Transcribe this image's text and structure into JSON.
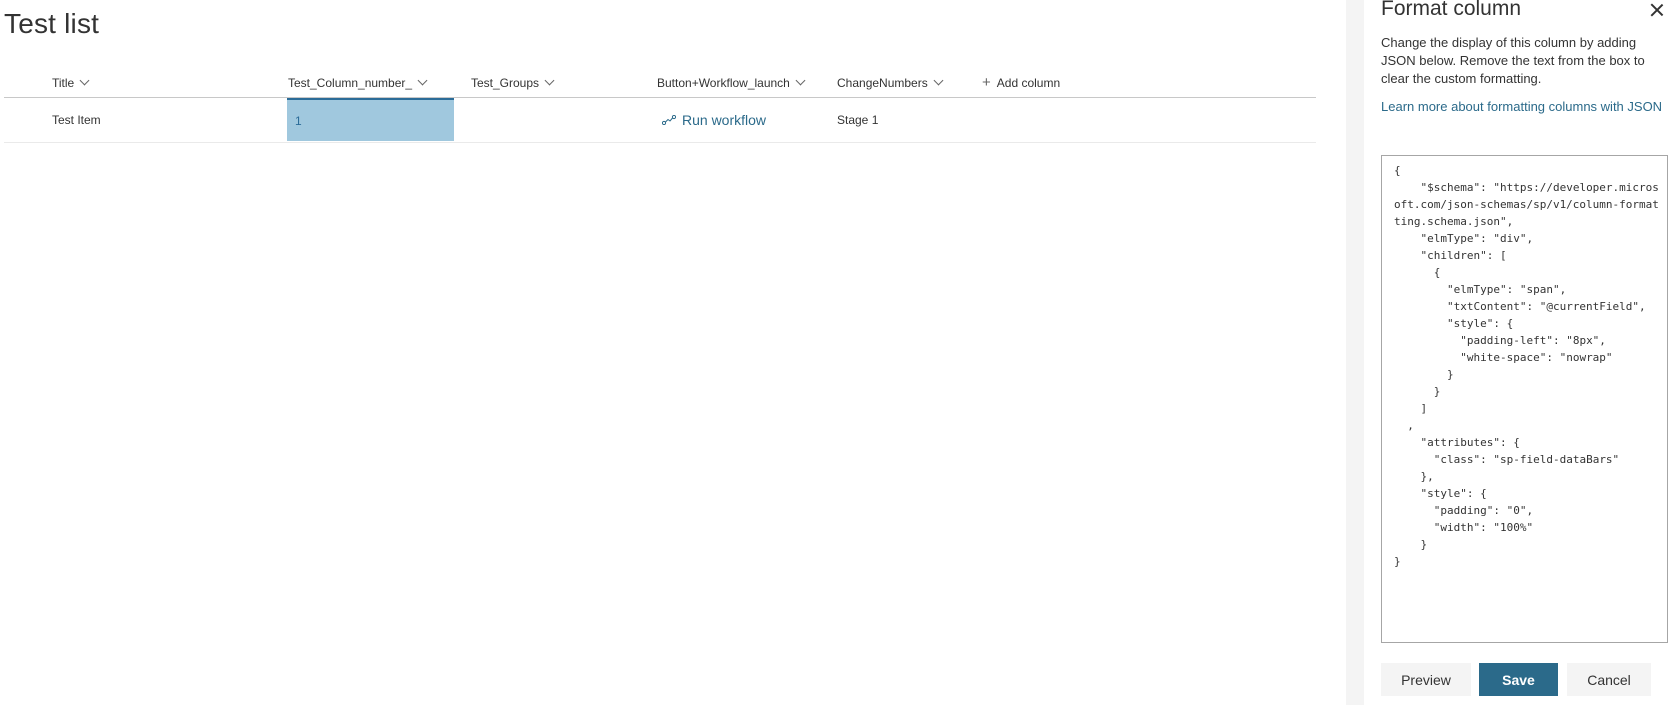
{
  "list": {
    "title": "Test list",
    "columns": [
      {
        "label": "Title"
      },
      {
        "label": "Test_Column_number_"
      },
      {
        "label": "Test_Groups"
      },
      {
        "label": "Button+Workflow_launch"
      },
      {
        "label": "ChangeNumbers"
      }
    ],
    "add_column_label": "Add column",
    "rows": [
      {
        "title": "Test Item",
        "number": "1",
        "number_bar_fraction": 1,
        "groups": "",
        "workflow_label": "Run workflow",
        "change_numbers": "Stage 1"
      }
    ]
  },
  "panel": {
    "title": "Format column",
    "description": "Change the display of this column by adding JSON below. Remove the text from the box to clear the custom formatting.",
    "learn_more_link": "Learn more about formatting columns with JSON",
    "json_text": "{\n    \"$schema\": \"https://developer.microsoft.com/json-schemas/sp/v1/column-formatting.schema.json\",\n    \"elmType\": \"div\",\n    \"children\": [\n      {\n        \"elmType\": \"span\",\n        \"txtContent\": \"@currentField\",\n        \"style\": {\n          \"padding-left\": \"8px\",\n          \"white-space\": \"nowrap\"\n        }\n      }\n    ]\n  ,\n    \"attributes\": {\n      \"class\": \"sp-field-dataBars\"\n    },\n    \"style\": {\n      \"padding\": \"0\",\n      \"width\": \"100%\"\n    }\n}",
    "buttons": {
      "preview": "Preview",
      "save": "Save",
      "cancel": "Cancel"
    }
  },
  "colors": {
    "accent": "#2b6a8a",
    "databar": "#a0c8de"
  },
  "icons": {
    "close": "close-icon",
    "column_menu": "chevron-down-icon",
    "add": "plus-icon",
    "workflow": "workflow-icon"
  }
}
